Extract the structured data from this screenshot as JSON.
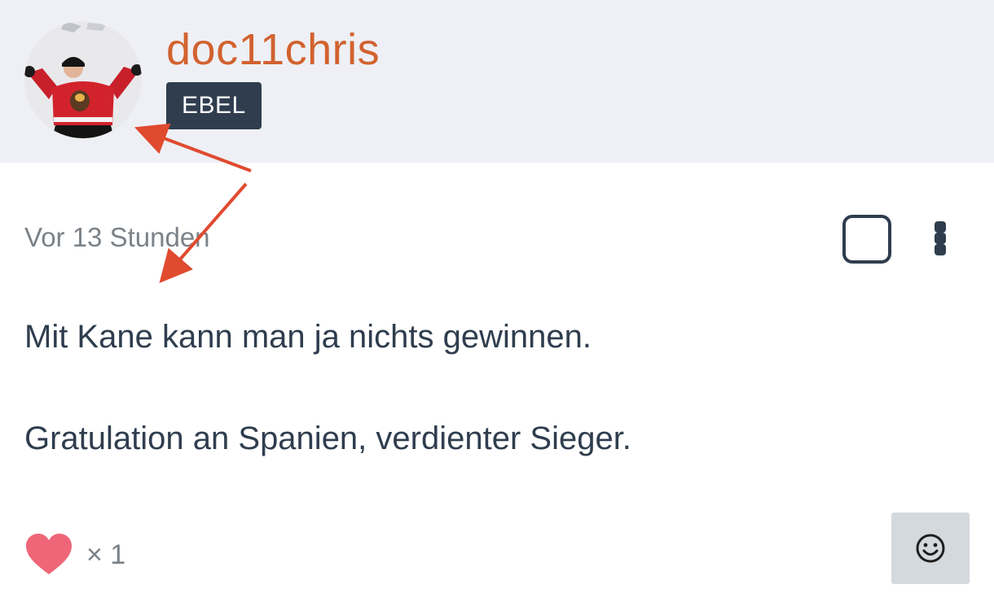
{
  "post": {
    "author": {
      "username": "doc11chris",
      "badge": "EBEL",
      "avatar_icon": "hockey-player-avatar"
    },
    "timestamp": "Vor 13 Stunden",
    "body_lines": [
      "Mit Kane kann man ja nichts gewinnen.",
      "Gratulation an Spanien, verdienter Sieger."
    ],
    "reactions": {
      "icon": "heart-icon",
      "count_label": "× 1"
    },
    "actions": {
      "select_icon": "checkbox-square-icon",
      "menu_icon": "more-vertical-icon",
      "emoji_icon": "smiley-icon"
    }
  },
  "colors": {
    "header_bg": "#eef0f5",
    "username": "#d2622f",
    "badge_bg": "#2f3d4e",
    "text": "#2f3d4e",
    "muted_text": "#7b8288",
    "heart": "#ee6677",
    "emoji_button_bg": "#d4d9de",
    "annotation_arrow": "#e04a2f"
  }
}
